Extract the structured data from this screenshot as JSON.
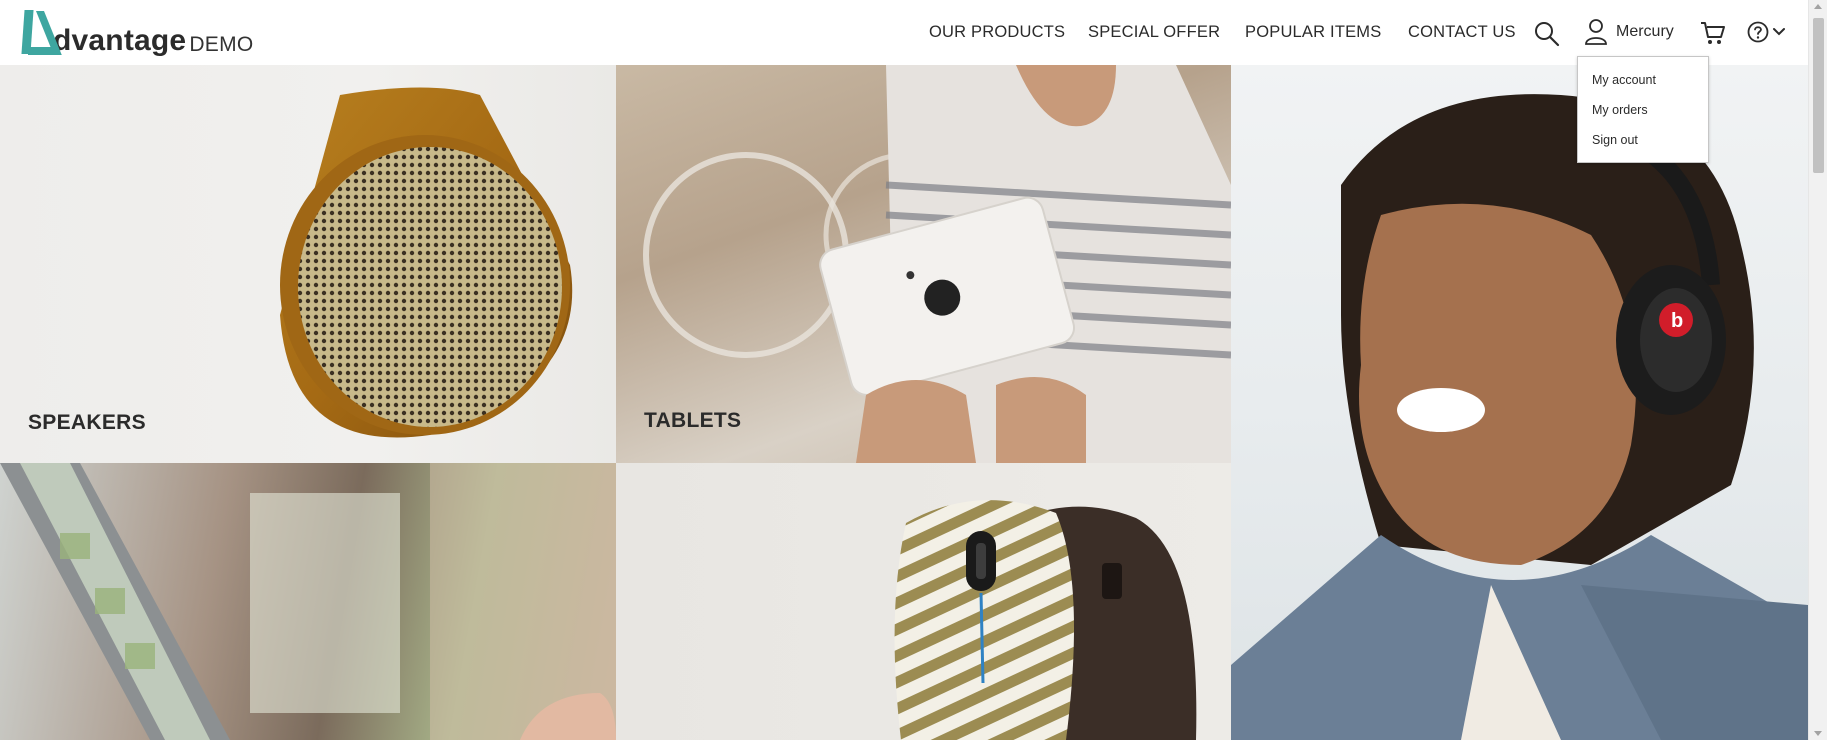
{
  "header": {
    "logo": {
      "word": "dvantage",
      "demo": "DEMO"
    },
    "nav": [
      "OUR PRODUCTS",
      "SPECIAL OFFER",
      "POPULAR ITEMS",
      "CONTACT US"
    ],
    "user_name": "Mercury",
    "icons": [
      "search-icon",
      "user-icon",
      "cart-icon",
      "help-icon",
      "chevron-down-icon"
    ]
  },
  "user_menu": {
    "items": [
      "My account",
      "My orders",
      "Sign out"
    ]
  },
  "categories": {
    "speakers": "SPEAKERS",
    "tablets": "TABLETS",
    "headphones": "",
    "laptops": "",
    "mice": ""
  },
  "colors": {
    "brand": "#3ea6a0",
    "text": "#2b2b2b"
  }
}
